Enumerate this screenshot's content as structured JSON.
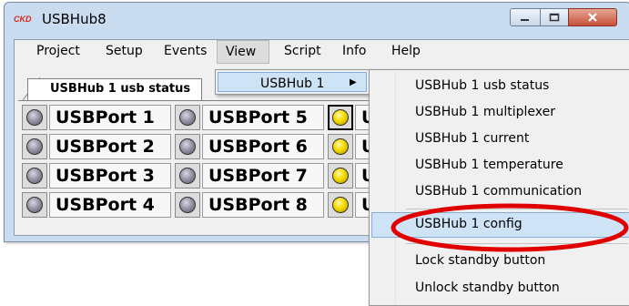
{
  "window": {
    "title": "USBHub8",
    "logo_text": "CKD"
  },
  "titlebar_buttons": {
    "minimize": "minimize-icon",
    "maximize": "maximize-icon",
    "close": "close-icon"
  },
  "menubar": {
    "items": [
      {
        "label": "Project"
      },
      {
        "label": "Setup"
      },
      {
        "label": "Events"
      },
      {
        "label": "View"
      },
      {
        "label": "Script"
      },
      {
        "label": "Info"
      },
      {
        "label": "Help"
      }
    ]
  },
  "tab": {
    "label": "USBHub 1 usb status"
  },
  "ports": [
    {
      "label": "USBPort 1",
      "led": "grey"
    },
    {
      "label": "USBPort 2",
      "led": "grey"
    },
    {
      "label": "USBPort 3",
      "led": "grey"
    },
    {
      "label": "USBPort 4",
      "led": "grey"
    },
    {
      "label": "USBPort 5",
      "led": "grey"
    },
    {
      "label": "USBPort 6",
      "led": "grey"
    },
    {
      "label": "USBPort 7",
      "led": "grey"
    },
    {
      "label": "USBPort 8",
      "led": "grey"
    },
    {
      "label": "U",
      "led": "yellow"
    },
    {
      "label": "U",
      "led": "yellow"
    },
    {
      "label": "U",
      "led": "yellow"
    },
    {
      "label": "U",
      "led": "yellow"
    }
  ],
  "view_menu": {
    "item": "USBHub 1"
  },
  "flyout": {
    "items": [
      "USBHub 1 usb status",
      "USBHub 1 multiplexer",
      "USBHub 1 current",
      "USBHub 1 temperature",
      "USBHub 1 communication",
      "USBHub 1 config",
      "Lock standby button",
      "Unlock standby button"
    ],
    "selected_index": 5
  },
  "colors": {
    "annotation": "#e00000",
    "led_grey": "#9696a8",
    "led_yellow": "#f2d900",
    "highlight": "#cfe3f7"
  }
}
